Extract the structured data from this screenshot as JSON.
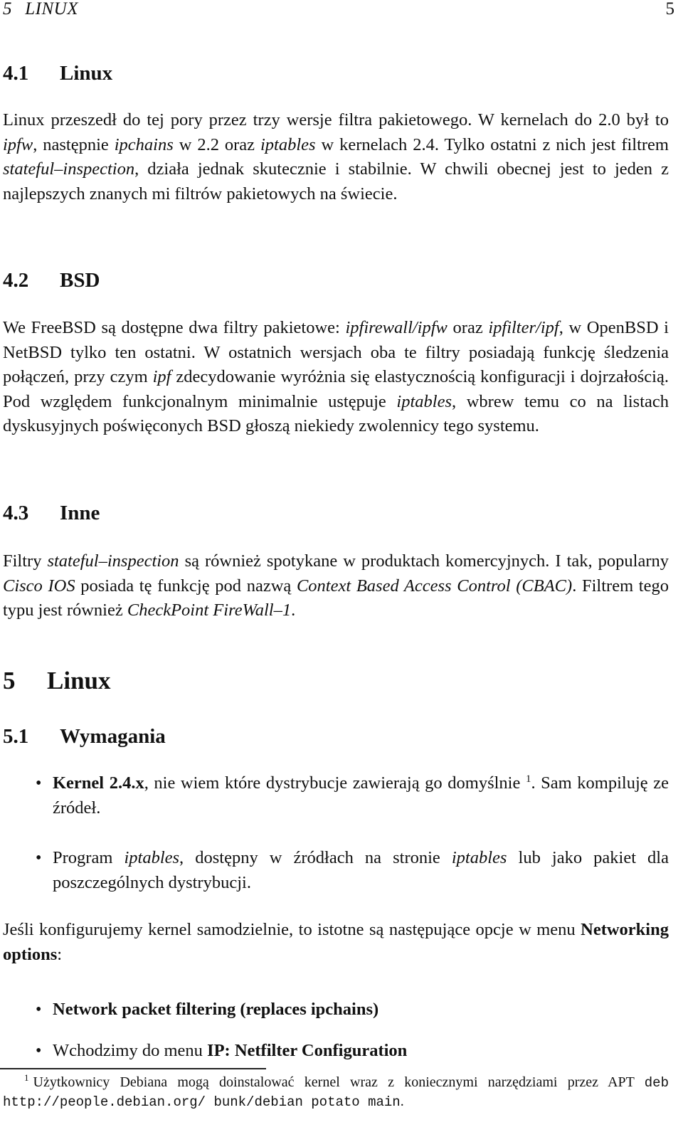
{
  "running_header": {
    "chapter_number": "5",
    "chapter_title": "LINUX",
    "page_number": "5"
  },
  "sections": {
    "s41": {
      "number": "4.1",
      "title": "Linux",
      "paragraph": {
        "t1": "Linux przeszedł do tej pory przez trzy wersje filtra pakietowego. W kernelach do 2.0 był to ",
        "i1": "ipfw",
        "t2": ", następnie ",
        "i2": "ipchains",
        "t3": " w 2.2 oraz ",
        "i3": "iptables",
        "t4": " w kernelach 2.4. Tylko ostatni z nich jest filtrem ",
        "i4": "stateful–inspection",
        "t5": ", działa jednak skutecznie i stabilnie. W chwili obecnej jest to jeden z najlepszych znanych mi filtrów pakietowych na świecie."
      }
    },
    "s42": {
      "number": "4.2",
      "title": "BSD",
      "paragraph": {
        "t1": "We FreeBSD są dostępne dwa filtry pakietowe: ",
        "i1": "ipfirewall/ipfw",
        "t2": " oraz ",
        "i2": "ipfilter/ipf",
        "t3": ", w OpenBSD i NetBSD tylko ten ostatni. W ostatnich wersjach oba te filtry posiadają funkcję śledzenia połączeń, przy czym ",
        "i3": "ipf",
        "t4": " zdecydowanie wyróżnia się elastycznością konfiguracji i dojrzałością. Pod względem funkcjonalnym minimalnie ustępuje ",
        "i4": "iptables",
        "t5": ", wbrew temu co na listach dyskusyjnych poświęconych BSD głoszą niekiedy zwolennicy tego systemu."
      }
    },
    "s43": {
      "number": "4.3",
      "title": "Inne",
      "paragraph": {
        "t1": "Filtry ",
        "i1": "stateful–inspection",
        "t2": " są również spotykane w produktach komercyjnych. I tak, popularny ",
        "i2": "Cisco IOS",
        "t3": " posiada tę funkcję pod nazwą ",
        "i3": "Context Based Access Control (CBAC)",
        "t4": ". Filtrem tego typu jest również ",
        "i4": "CheckPoint FireWall–1",
        "t5": "."
      }
    },
    "ch5": {
      "number": "5",
      "title": "Linux"
    },
    "s51": {
      "number": "5.1",
      "title": "Wymagania",
      "requirements": [
        {
          "bold": "Kernel 2.4.x",
          "text": ", nie wiem które dystrybucje zawierają go domyślnie ",
          "footnote_ref": "1",
          "after": ". Sam kompiluję ze źródeł."
        },
        {
          "t1": "Program ",
          "i1": "iptables",
          "t2": ", dostępny w źródłach na stronie ",
          "i2": "iptables",
          "t3": " lub jako pakiet dla poszczególnych dystrybucji."
        }
      ],
      "config_paragraph": {
        "t1": "Jeśli konfigurujemy kernel samodzielnie, to istotne są następujące opcje w menu ",
        "b1": "Networking options",
        "t2": ":"
      },
      "options": [
        {
          "bold": "Network packet filtering (replaces ipchains)"
        },
        {
          "text": "Wchodzimy do menu ",
          "bold": "IP: Netfilter Configuration"
        }
      ]
    }
  },
  "footnote": {
    "mark": "1",
    "t1": "Użytkownicy Debiana mogą doinstalować kernel wraz z koniecznymi narzędziami przez APT ",
    "code": "deb http://people.debian.org/ bunk/debian potato main",
    "t2": "."
  }
}
